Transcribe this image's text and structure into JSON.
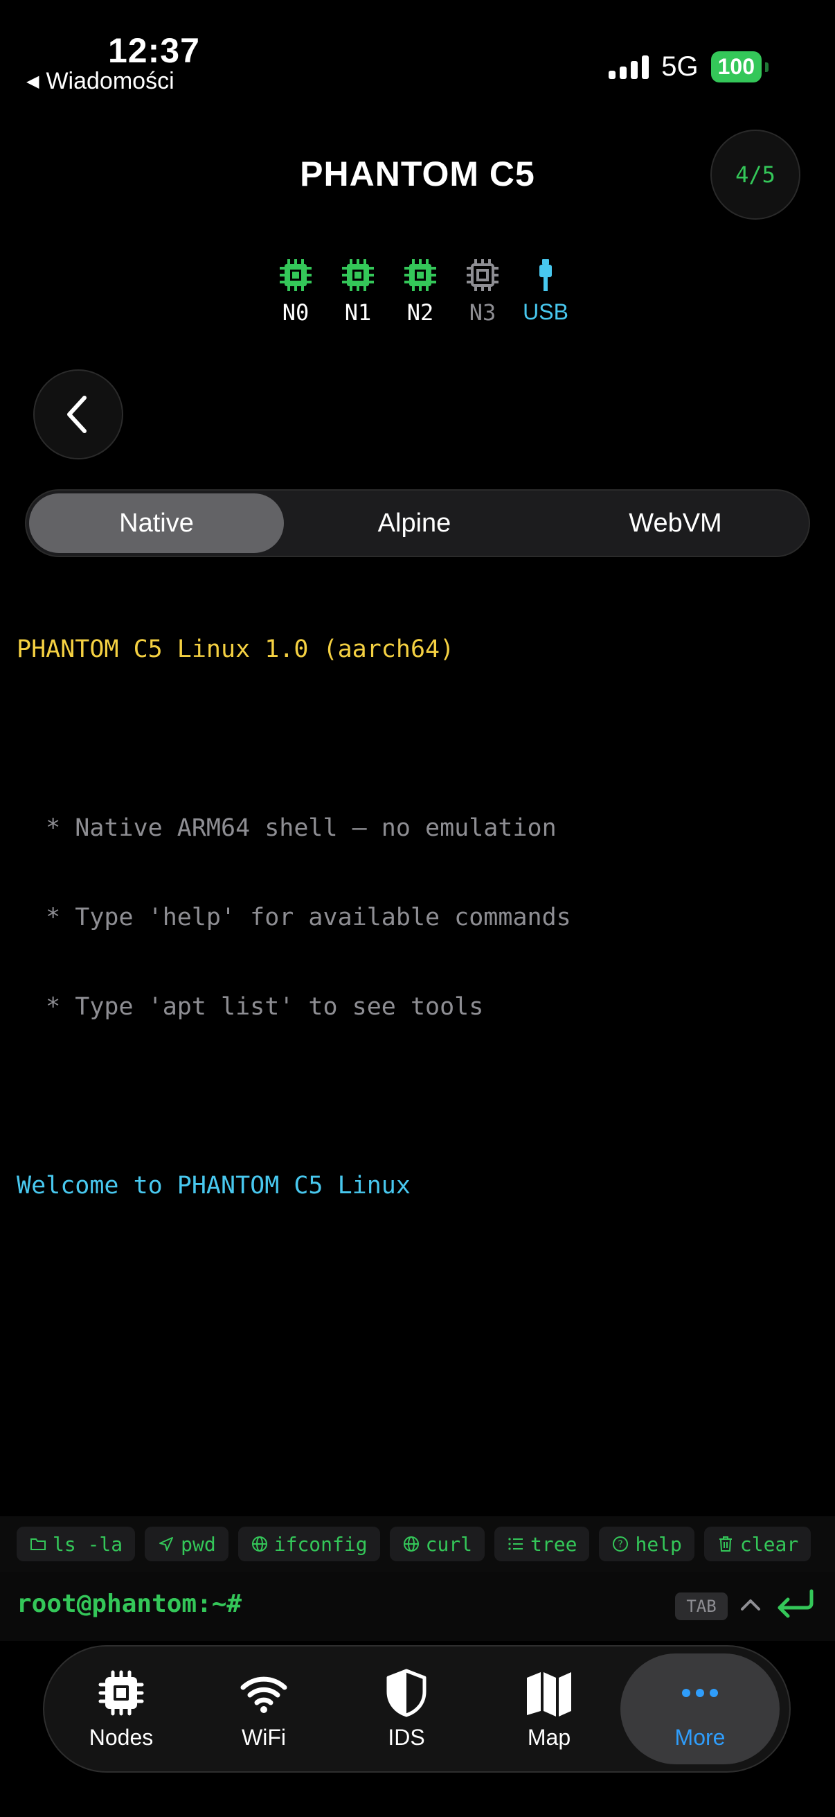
{
  "status": {
    "time": "12:37",
    "back_label": "Wiadomości",
    "network": "5G",
    "battery": "100"
  },
  "header": {
    "title": "PHANTOM C5",
    "page_indicator": "4/5"
  },
  "nodes": [
    {
      "label": "N0",
      "color": "#34c759"
    },
    {
      "label": "N1",
      "color": "#34c759"
    },
    {
      "label": "N2",
      "color": "#34c759"
    },
    {
      "label": "N3",
      "color": "#8e8e93"
    },
    {
      "label": "USB",
      "color": "#48c8ef"
    }
  ],
  "segments": [
    "Native",
    "Alpine",
    "WebVM"
  ],
  "terminal": {
    "banner": "PHANTOM C5 Linux 1.0 (aarch64)",
    "lines": [
      "  * Native ARM64 shell — no emulation",
      "  * Type 'help' for available commands",
      "  * Type 'apt list' to see tools"
    ],
    "welcome": "Welcome to PHANTOM C5 Linux"
  },
  "quick_commands": [
    {
      "icon": "folder-icon",
      "label": "ls -la"
    },
    {
      "icon": "navigation-icon",
      "label": "pwd"
    },
    {
      "icon": "globe-icon",
      "label": "ifconfig"
    },
    {
      "icon": "globe-icon",
      "label": "curl"
    },
    {
      "icon": "list-icon",
      "label": "tree"
    },
    {
      "icon": "help-icon",
      "label": "help"
    },
    {
      "icon": "trash-icon",
      "label": "clear"
    }
  ],
  "prompt": {
    "text": "root@phantom:~#",
    "tab_label": "TAB"
  },
  "tabbar": [
    {
      "icon": "cpu-icon",
      "label": "Nodes"
    },
    {
      "icon": "wifi-icon",
      "label": "WiFi"
    },
    {
      "icon": "shield-icon",
      "label": "IDS"
    },
    {
      "icon": "map-icon",
      "label": "Map"
    },
    {
      "icon": "more-icon",
      "label": "More"
    }
  ],
  "colors": {
    "accent_green": "#34c759",
    "accent_blue": "#2f9dfb",
    "terminal_yellow": "#f5d142",
    "terminal_cyan": "#48c8ef"
  }
}
